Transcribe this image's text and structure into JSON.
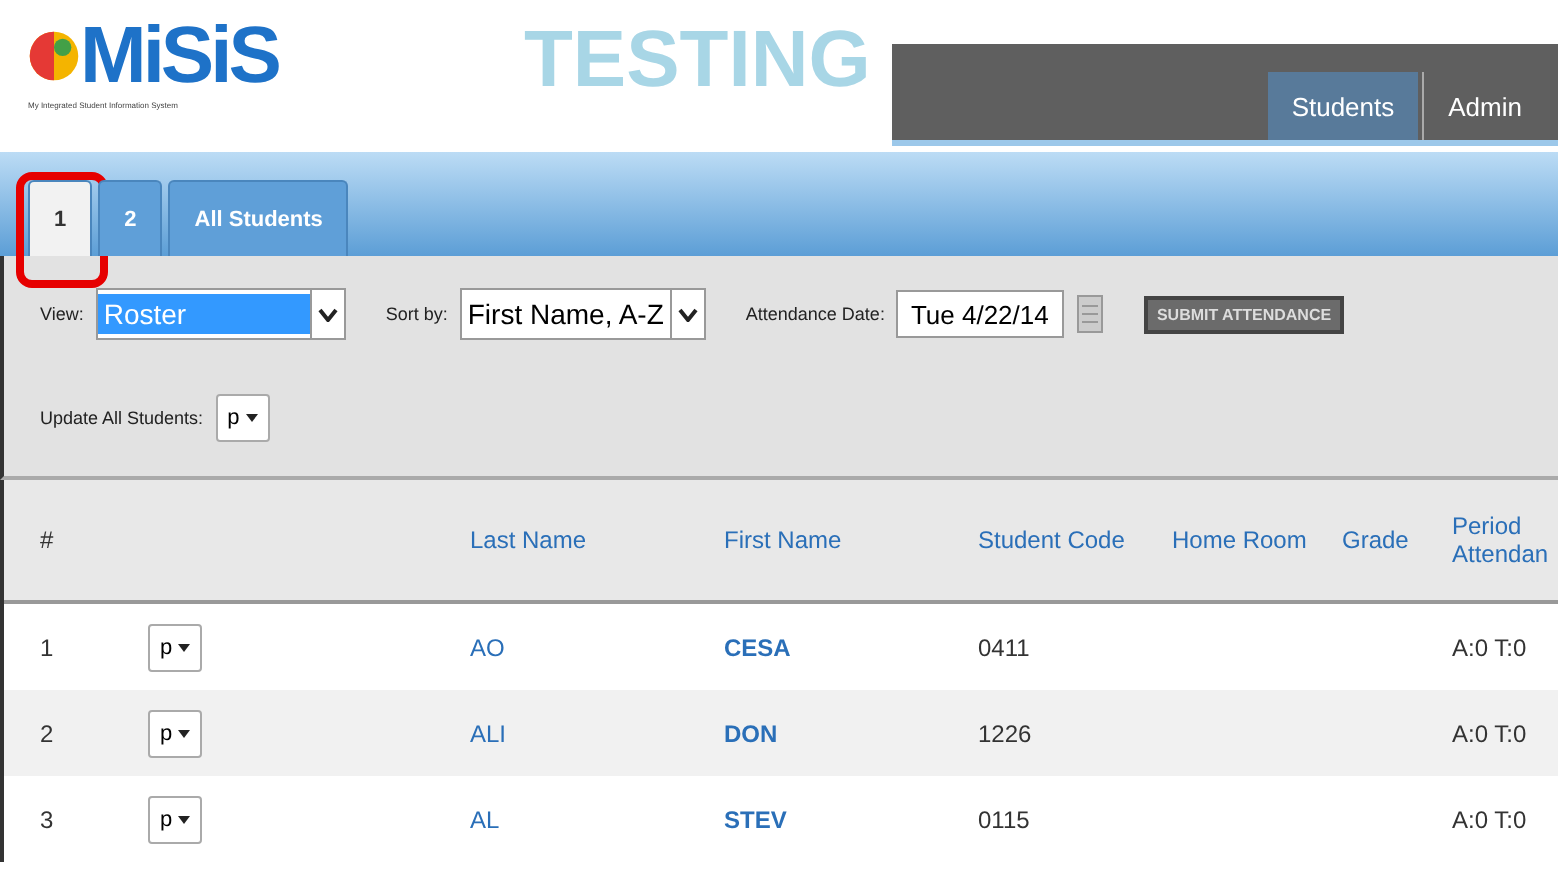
{
  "logo": {
    "name": "MiSiS",
    "tagline": "My Integrated Student Information System"
  },
  "environment": "TESTING",
  "nav_tabs": [
    {
      "label": "Students",
      "selected": true
    },
    {
      "label": "Admin",
      "selected": false
    }
  ],
  "section_tabs": [
    {
      "label": "1",
      "selected": true,
      "highlighted": true
    },
    {
      "label": "2",
      "selected": false,
      "highlighted": false
    },
    {
      "label": "All Students",
      "selected": false,
      "highlighted": false
    }
  ],
  "filters": {
    "view_label": "View:",
    "view_value": "Roster",
    "sort_label": "Sort by:",
    "sort_value": "First Name, A-Z",
    "date_label": "Attendance Date:",
    "date_value": "Tue 4/22/14",
    "submit": "SUBMIT ATTENDANCE",
    "update_label": "Update All Students:",
    "update_value": "p"
  },
  "table": {
    "columns": [
      "#",
      "",
      "Last Name",
      "First Name",
      "Student Code",
      "Home Room",
      "Grade",
      "Period Attendan"
    ],
    "rows": [
      {
        "num": "1",
        "status": "p",
        "last_name": "AO",
        "first_name": "CESA",
        "code": "0411",
        "home_room": "",
        "grade": "",
        "period": "A:0 T:0"
      },
      {
        "num": "2",
        "status": "p",
        "last_name": "ALI",
        "first_name": "DON",
        "code": "1226",
        "home_room": "",
        "grade": "",
        "period": "A:0 T:0"
      },
      {
        "num": "3",
        "status": "p",
        "last_name": "AL",
        "first_name": "STEV",
        "code": "0115",
        "home_room": "",
        "grade": "",
        "period": "A:0 T:0"
      }
    ]
  }
}
